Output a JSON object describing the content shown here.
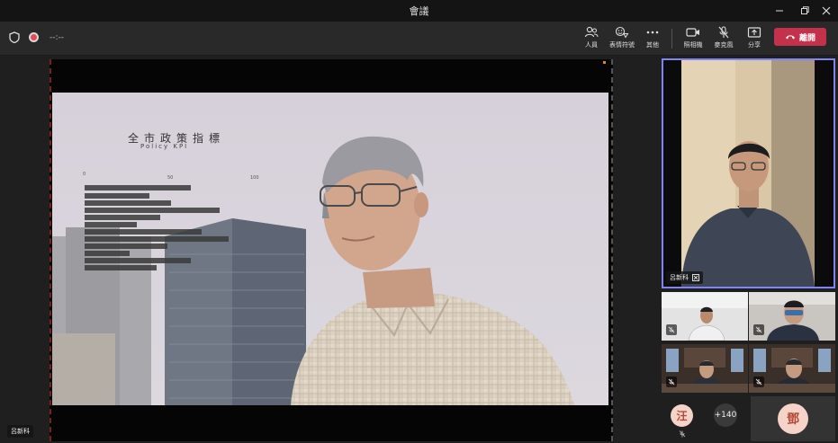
{
  "window": {
    "title": "會議"
  },
  "toolbar": {
    "timer": "--:--",
    "buttons": [
      {
        "label": "人員",
        "icon": "people-icon"
      },
      {
        "label": "表情符號",
        "icon": "emoji-icon"
      },
      {
        "label": "其他",
        "icon": "more-icon"
      },
      {
        "label": "照相機",
        "icon": "camera-icon"
      },
      {
        "label": "麥克風",
        "icon": "mic-off-icon"
      },
      {
        "label": "分享",
        "icon": "share-icon"
      }
    ],
    "leave_label": "離開"
  },
  "presenter": {
    "name": "呂新科"
  },
  "shared_video": {
    "title": "全市政策指標",
    "subtitle": "Policy KPI",
    "scale_labels": [
      "0",
      "50",
      "100"
    ]
  },
  "participants": {
    "main_tile_name": "呂新科",
    "avatar_1": "汪",
    "overflow_count": "+140",
    "avatar_2": "鄧"
  },
  "colors": {
    "leave": "#c4314b",
    "active_border": "#7f85f5",
    "record": "#e04e55"
  }
}
